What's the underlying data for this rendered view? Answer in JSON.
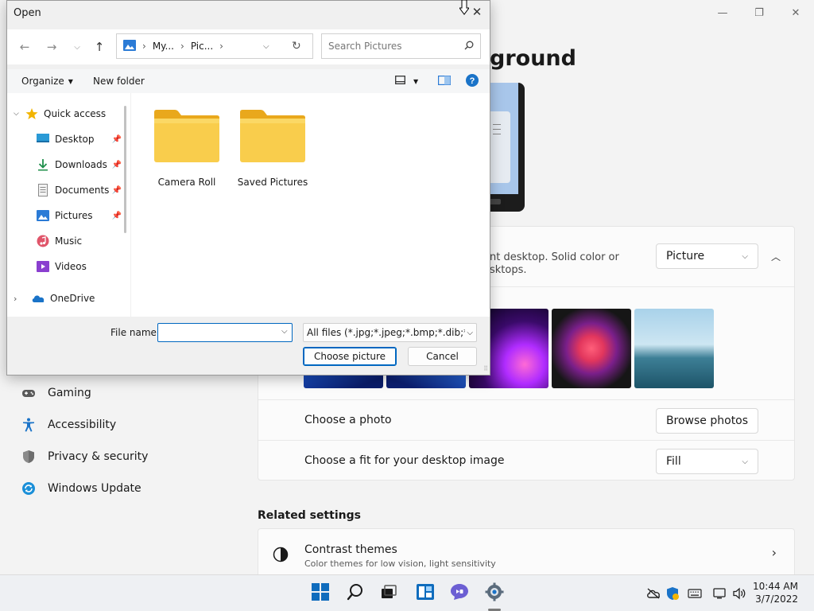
{
  "settings": {
    "page_title": "ground",
    "bg_desc_line1": "nt desktop. Solid color or",
    "bg_desc_line2": "sktops.",
    "bg_type": "Picture",
    "choose_photo_label": "Choose a photo",
    "browse_photos": "Browse photos",
    "fit_label": "Choose a fit for your desktop image",
    "fit_value": "Fill",
    "related_settings": "Related settings",
    "contrast_title": "Contrast themes",
    "contrast_desc": "Color themes for low vision, light sensitivity"
  },
  "nav": {
    "items": [
      {
        "label": "Gaming",
        "icon": "gamepad-icon"
      },
      {
        "label": "Accessibility",
        "icon": "accessibility-icon"
      },
      {
        "label": "Privacy & security",
        "icon": "shield-icon"
      },
      {
        "label": "Windows Update",
        "icon": "update-icon"
      }
    ]
  },
  "dialog": {
    "title": "Open",
    "breadcrumb": [
      "My...",
      "Pic..."
    ],
    "search_placeholder": "Search Pictures",
    "toolbar": {
      "organize": "Organize",
      "new_folder": "New folder"
    },
    "tree": [
      {
        "label": "Quick access",
        "icon": "star-icon"
      },
      {
        "label": "Desktop",
        "icon": "desktop-icon",
        "pinned": true
      },
      {
        "label": "Downloads",
        "icon": "download-icon",
        "pinned": true
      },
      {
        "label": "Documents",
        "icon": "document-icon",
        "pinned": true
      },
      {
        "label": "Pictures",
        "icon": "picture-icon",
        "pinned": true
      },
      {
        "label": "Music",
        "icon": "music-icon"
      },
      {
        "label": "Videos",
        "icon": "video-icon"
      },
      {
        "label": "OneDrive",
        "icon": "cloud-icon"
      }
    ],
    "folders": [
      "Camera Roll",
      "Saved Pictures"
    ],
    "file_name_label": "File name:",
    "file_name_value": "",
    "filter": "All files (*.jpg;*.jpeg;*.bmp;*.dib;*.png",
    "choose_button": "Choose picture",
    "cancel_button": "Cancel"
  },
  "clock": {
    "time": "10:44 AM",
    "date": "3/7/2022"
  },
  "colors": {
    "accent": "#0067c0",
    "folder": "#f8c53a"
  }
}
